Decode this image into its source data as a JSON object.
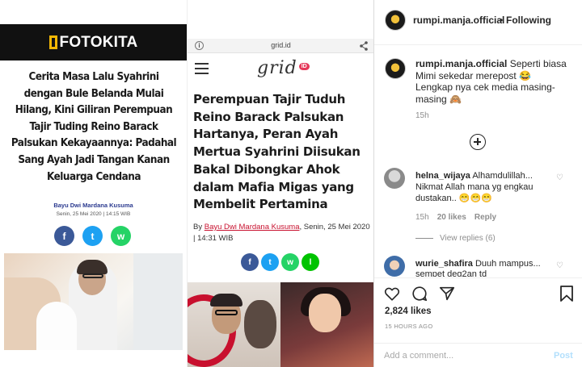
{
  "fotokita": {
    "logo": "FOTOKITA",
    "title": "Cerita Masa Lalu Syahrini dengan Bule Belanda Mulai Hilang, Kini Giliran Perempuan Tajir Tuding Reino Barack Palsukan Kekayaannya: Padahal Sang Ayah Jadi Tangan Kanan Keluarga Cendana",
    "author": "Bayu Dwi Mardana Kusuma",
    "date": "Senin, 25 Mei 2020 | 14:15 WIB",
    "share": [
      "f",
      "t",
      "w"
    ]
  },
  "grid": {
    "url": "grid.id",
    "logo": "grid",
    "logo_badge": "ID",
    "title": "Perempuan Tajir Tuduh Reino Barack Palsukan Hartanya, Peran Ayah Mertua Syahrini Diisukan Bakal Dibongkar Ahok dalam Mafia Migas yang Membelit Pertamina",
    "byline_prefix": "By",
    "author": "Bayu Dwi Mardana Kusuma",
    "byline_suffix": ", Senin, 25 Mei 2020 | 14:31 WIB",
    "share": [
      "f",
      "t",
      "w",
      "l"
    ]
  },
  "instagram": {
    "header": {
      "username": "rumpi.manja.official",
      "dot": "•",
      "follow": "Following"
    },
    "caption": {
      "username": "rumpi.manja.official",
      "text": " Seperti biasa Mimi sekedar merepost 😂 Lengkap nya cek media masing-masing 🙈",
      "time": "15h"
    },
    "comments": [
      {
        "username": "helna_wijaya",
        "text": " Alhamdulillah... Nikmat Allah mana yg engkau dustakan.. 😁😁😁",
        "time": "15h",
        "likes": "20 likes",
        "reply": "Reply",
        "view_replies": "View replies (6)"
      },
      {
        "username": "wurie_shafira",
        "text": " Duuh mampus... sempet deg2an td"
      }
    ],
    "likes": "2,824 likes",
    "posted_ago": "15 HOURS AGO",
    "comment_placeholder": "Add a comment...",
    "post_button": "Post"
  }
}
